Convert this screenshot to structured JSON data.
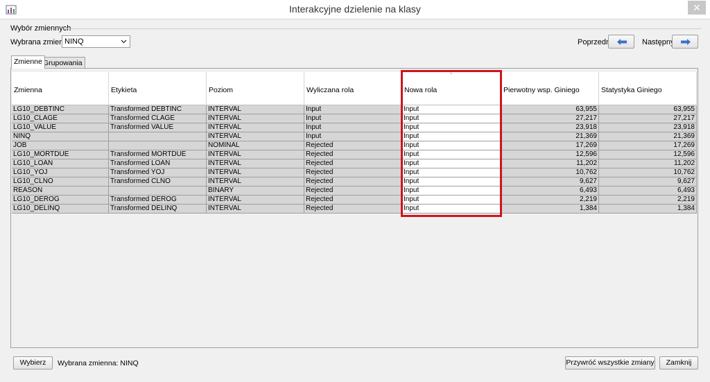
{
  "window": {
    "title": "Interakcyjne dzielenie na klasy",
    "close_glyph": "✕"
  },
  "selection": {
    "group_label": "Wybór zmiennych",
    "variable_label": "Wybrana zmienna",
    "variable_value": "NINQ",
    "prev_label": "Poprzedni",
    "next_label": "Następny"
  },
  "tabs": [
    {
      "label": "Zmienne",
      "active": true
    },
    {
      "label": "Grupowania",
      "active": false
    }
  ],
  "table": {
    "sort_indicator": "ˆ",
    "columns": [
      "Zmienna",
      "Etykieta",
      "Poziom",
      "Wyliczana rola",
      "Nowa rola",
      "Pierwotny wsp. Giniego",
      "Statystyka Giniego"
    ],
    "rows": [
      [
        "LG10_DEBTINC",
        "Transformed DEBTINC",
        "INTERVAL",
        "Input",
        "Input",
        "63,955",
        "63,955"
      ],
      [
        "LG10_CLAGE",
        "Transformed CLAGE",
        "INTERVAL",
        "Input",
        "Input",
        "27,217",
        "27,217"
      ],
      [
        "LG10_VALUE",
        "Transformed VALUE",
        "INTERVAL",
        "Input",
        "Input",
        "23,918",
        "23,918"
      ],
      [
        "NINQ",
        "",
        "INTERVAL",
        "Input",
        "Input",
        "21,369",
        "21,369"
      ],
      [
        "JOB",
        "",
        "NOMINAL",
        "Rejected",
        "Input",
        "17,269",
        "17,269"
      ],
      [
        "LG10_MORTDUE",
        "Transformed MORTDUE",
        "INTERVAL",
        "Rejected",
        "Input",
        "12,596",
        "12,596"
      ],
      [
        "LG10_LOAN",
        "Transformed LOAN",
        "INTERVAL",
        "Rejected",
        "Input",
        "11,202",
        "11,202"
      ],
      [
        "LG10_YOJ",
        "Transformed YOJ",
        "INTERVAL",
        "Rejected",
        "Input",
        "10,762",
        "10,762"
      ],
      [
        "LG10_CLNO",
        "Transformed CLNO",
        "INTERVAL",
        "Rejected",
        "Input",
        "9,627",
        "9,627"
      ],
      [
        "REASON",
        "",
        "BINARY",
        "Rejected",
        "Input",
        "6,493",
        "6,493"
      ],
      [
        "LG10_DEROG",
        "Transformed DEROG",
        "INTERVAL",
        "Rejected",
        "Input",
        "2,219",
        "2,219"
      ],
      [
        "LG10_DELINQ",
        "Transformed DELINQ",
        "INTERVAL",
        "Rejected",
        "Input",
        "1,384",
        "1,384"
      ]
    ]
  },
  "footer": {
    "select_button": "Wybierz",
    "status_text": "Wybrana zmienna:  NINQ",
    "restore_button": "Przywróć wszystkie zmiany",
    "close_button": "Zamknij"
  },
  "colors": {
    "highlight": "#d0141c",
    "row_bg": "#d6d6d6",
    "edit_bg": "#ffffff",
    "nav_arrow": "#3b6fc9"
  }
}
